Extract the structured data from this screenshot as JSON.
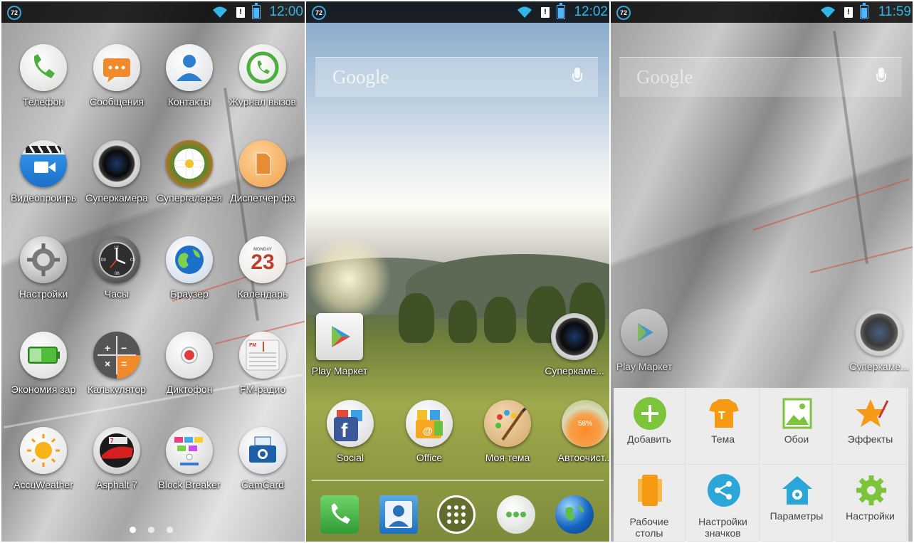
{
  "status_bars": [
    {
      "badge": "72",
      "time": "12:00"
    },
    {
      "badge": "72",
      "time": "12:02"
    },
    {
      "badge": "72",
      "time": "11:59"
    }
  ],
  "status_alert": "!",
  "app_drawer": {
    "apps": [
      {
        "label": "Телефон",
        "icon": "phone-icon"
      },
      {
        "label": "Сообщения",
        "icon": "messages-icon"
      },
      {
        "label": "Контакты",
        "icon": "contacts-icon"
      },
      {
        "label": "Журнал вызов",
        "icon": "call-log-icon"
      },
      {
        "label": "Видеопроигрь",
        "icon": "video-player-icon"
      },
      {
        "label": "Суперкамера",
        "icon": "camera-icon"
      },
      {
        "label": "Супергалерея",
        "icon": "gallery-icon"
      },
      {
        "label": "Диспетчер фа",
        "icon": "file-manager-icon"
      },
      {
        "label": "Настройки",
        "icon": "settings-icon"
      },
      {
        "label": "Часы",
        "icon": "clock-icon"
      },
      {
        "label": "Браузер",
        "icon": "browser-icon"
      },
      {
        "label": "Календарь",
        "icon": "calendar-icon"
      },
      {
        "label": "Экономия зар",
        "icon": "battery-saver-icon"
      },
      {
        "label": "Калькулятор",
        "icon": "calculator-icon"
      },
      {
        "label": "Диктофон",
        "icon": "recorder-icon"
      },
      {
        "label": "FM-радио",
        "icon": "radio-icon"
      },
      {
        "label": "AccuWeather",
        "icon": "weather-icon"
      },
      {
        "label": "Asphalt 7",
        "icon": "asphalt-icon"
      },
      {
        "label": "Block Breaker",
        "icon": "block-breaker-icon"
      },
      {
        "label": "CamCard",
        "icon": "camcard-icon"
      }
    ],
    "calendar": {
      "month": "MONDAY",
      "day": "23"
    },
    "radio_tag": "FM",
    "page_dots": 3,
    "active_page": 0
  },
  "home": {
    "search_logo": "Google",
    "shortcuts": [
      {
        "label": "Play Маркет",
        "icon": "play-store-icon"
      },
      {
        "label": "Суперкаме...",
        "icon": "camera-icon"
      }
    ],
    "folders": [
      {
        "label": "Social",
        "icon": "facebook-folder-icon"
      },
      {
        "label": "Office",
        "icon": "office-folder-icon"
      },
      {
        "label": "Моя тема",
        "icon": "theme-palette-icon"
      },
      {
        "label": "Автоочист...",
        "icon": "auto-clean-icon",
        "value": "58%"
      }
    ],
    "dock": [
      "phone-icon",
      "contacts-icon",
      "app-drawer-icon",
      "messages-icon",
      "browser-globe-icon"
    ]
  },
  "edit_mode": {
    "search_logo": "Google",
    "shortcuts": [
      {
        "label": "Play Маркет",
        "icon": "play-store-icon"
      },
      {
        "label": "Суперкаме...",
        "icon": "camera-icon"
      }
    ],
    "menu": [
      {
        "label": "Добавить",
        "icon": "add-icon"
      },
      {
        "label": "Тема",
        "icon": "theme-shirt-icon"
      },
      {
        "label": "Обои",
        "icon": "wallpaper-icon"
      },
      {
        "label": "Эффекты",
        "icon": "effects-star-icon"
      },
      {
        "label": "Рабочие\nстолы",
        "icon": "desktops-icon"
      },
      {
        "label": "Настройки\nзначков",
        "icon": "icon-settings-share-icon"
      },
      {
        "label": "Параметры",
        "icon": "home-settings-icon"
      },
      {
        "label": "Настройки",
        "icon": "gear-icon"
      }
    ]
  }
}
